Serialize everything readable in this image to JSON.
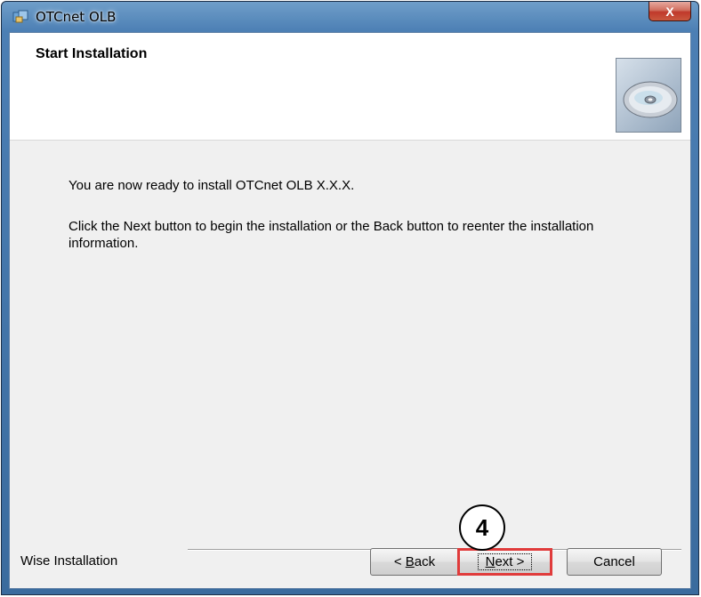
{
  "window": {
    "title": "OTCnet OLB",
    "close_label": "X"
  },
  "header": {
    "title": "Start Installation"
  },
  "body": {
    "line1": "You are now ready to install OTCnet OLB X.X.X.",
    "line2": "Click the Next button to begin the installation or the Back button to reenter the installation information."
  },
  "footer": {
    "brand": "Wise Installation",
    "buttons": {
      "back_prefix": "< ",
      "back_mnemonic": "B",
      "back_rest": "ack",
      "next_mnemonic": "N",
      "next_rest": "ext >",
      "cancel": "Cancel"
    }
  },
  "annotation": {
    "step": "4",
    "highlight_color": "#e03b3b"
  },
  "icons": {
    "app": "installer-app-icon",
    "header": "cd-disc-icon"
  }
}
